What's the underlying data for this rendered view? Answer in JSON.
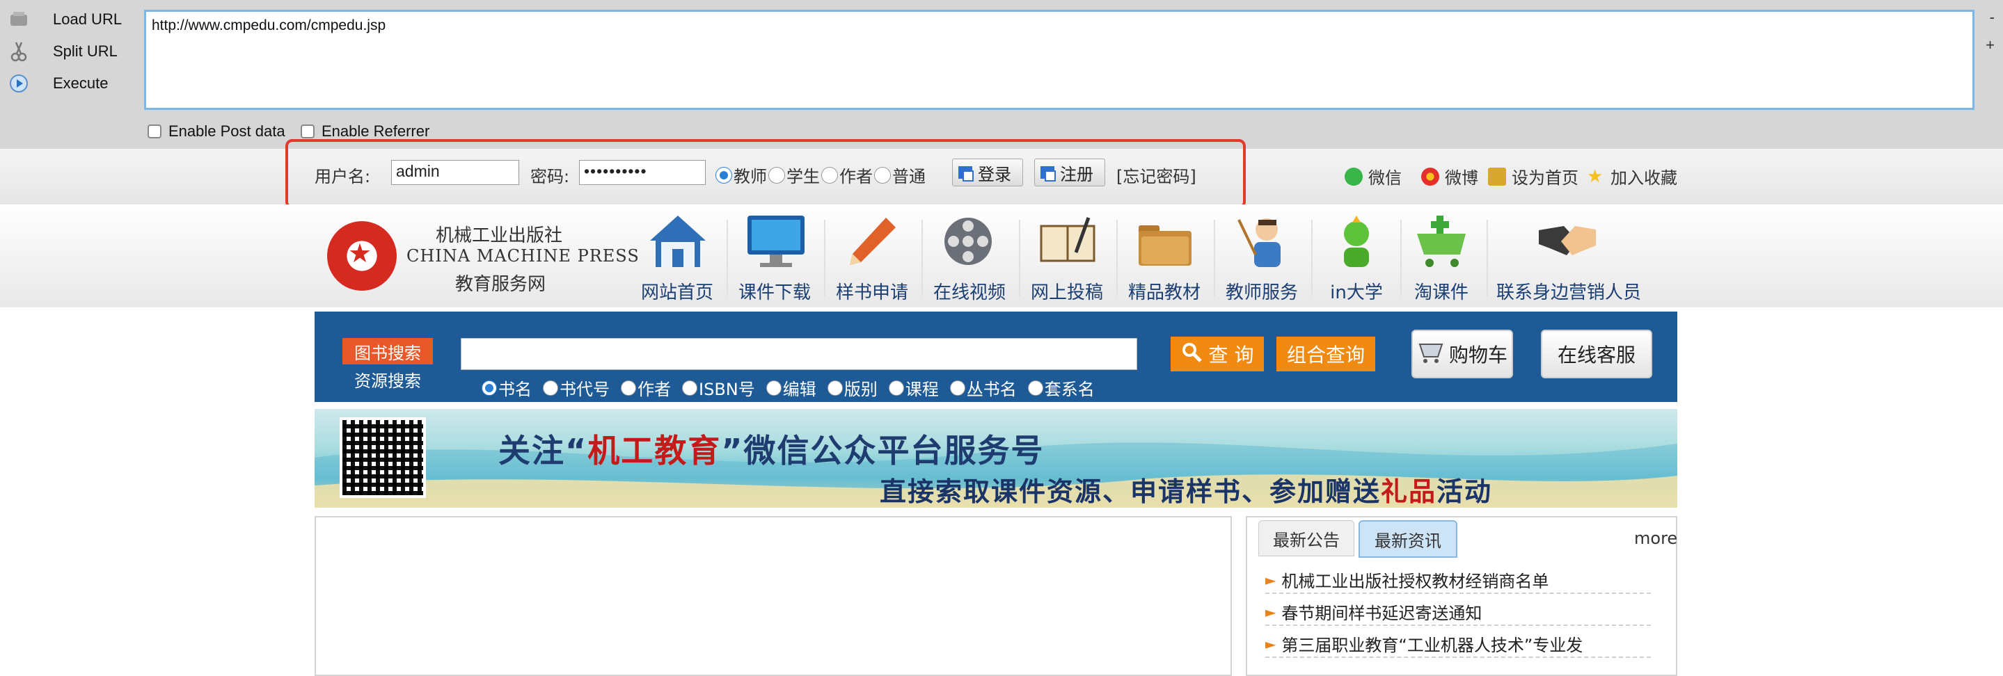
{
  "hackbar": {
    "load_url": "Load URL",
    "split_url": "Split URL",
    "execute": "Execute",
    "url_value": "http://www.cmpedu.com/cmpedu.jsp",
    "minus": "-",
    "plus": "+",
    "enable_post": "Enable Post data",
    "enable_referrer": "Enable Referrer"
  },
  "login": {
    "username_label": "用户名:",
    "username_value": "admin",
    "password_label": "密码:",
    "password_value": "••••••••••",
    "roles": [
      "教师",
      "学生",
      "作者",
      "普通"
    ],
    "login_button": "登录",
    "register_button": "注册",
    "forgot": "[忘记密码]"
  },
  "social": {
    "wechat": "微信",
    "weibo": "微博",
    "homepage": "设为首页",
    "favorite": "加入收藏"
  },
  "logo": {
    "cn": "机械工业出版社",
    "en": "CHINA MACHINE PRESS",
    "sub": "教育服务网"
  },
  "nav": [
    {
      "label": "网站首页",
      "icon": "house-icon"
    },
    {
      "label": "课件下载",
      "icon": "monitor-icon"
    },
    {
      "label": "样书申请",
      "icon": "pencil-icon"
    },
    {
      "label": "在线视频",
      "icon": "film-reel-icon"
    },
    {
      "label": "网上投稿",
      "icon": "book-pen-icon"
    },
    {
      "label": "精品教材",
      "icon": "folder-icon"
    },
    {
      "label": "教师服务",
      "icon": "teacher-icon"
    },
    {
      "label": "in大学",
      "icon": "graduate-icon"
    },
    {
      "label": "淘课件",
      "icon": "cart-icon"
    },
    {
      "label": "联系身边营销人员",
      "icon": "handshake-icon"
    }
  ],
  "search": {
    "tab_book": "图书搜索",
    "tab_resource": "资源搜索",
    "query_button": "查 询",
    "combo_button": "组合查询",
    "cart_button": "购物车",
    "service_button": "在线客服",
    "options": [
      "书名",
      "书代号",
      "作者",
      "ISBN号",
      "编辑",
      "版别",
      "课程",
      "丛书名",
      "套系名"
    ]
  },
  "banner": {
    "line1_a": "关注“",
    "line1_b": "机工教育",
    "line1_c": "”微信公众平台服务号",
    "line2_a": "直接索取课件资源、申请样书、参加赠送",
    "line2_b": "礼品",
    "line2_c": "活动"
  },
  "news": {
    "tab_notice": "最新公告",
    "tab_info": "最新资讯",
    "more": "more",
    "items": [
      "机械工业出版社授权教材经销商名单",
      "春节期间样书延迟寄送通知",
      "第三届职业教育“工业机器人技术”专业发"
    ]
  },
  "colors": {
    "accent_blue": "#1e5b96",
    "orange": "#f08a12",
    "highlight_red": "#e23b2e"
  }
}
